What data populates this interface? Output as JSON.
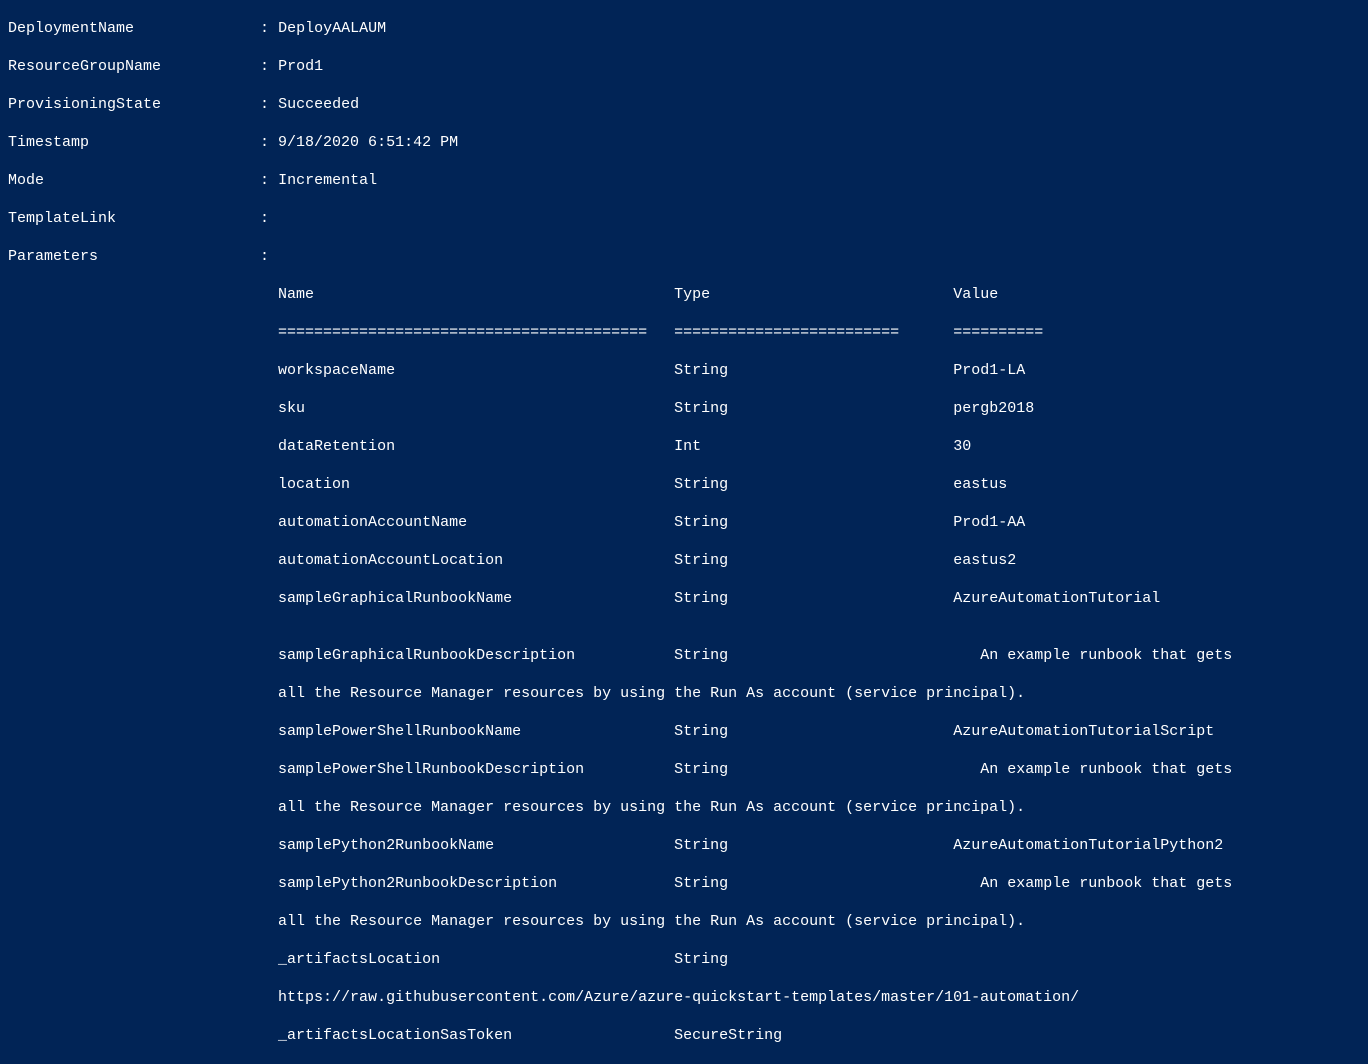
{
  "kv": {
    "deploymentName": {
      "label": "DeploymentName",
      "value": "DeployAALAUM"
    },
    "resourceGroupName": {
      "label": "ResourceGroupName",
      "value": "Prod1"
    },
    "provisioningState": {
      "label": "ProvisioningState",
      "value": "Succeeded"
    },
    "timestamp": {
      "label": "Timestamp",
      "value": "9/18/2020 6:51:42 PM"
    },
    "mode": {
      "label": "Mode",
      "value": "Incremental"
    },
    "templateLink": {
      "label": "TemplateLink",
      "value": ""
    },
    "parameters": {
      "label": "Parameters",
      "value": ""
    }
  },
  "paramsTable": {
    "header": {
      "name": "Name",
      "type": "Type",
      "value": "Value"
    },
    "sep": {
      "name": "=========================================",
      "type": "=========================",
      "value": "=========="
    },
    "rows": [
      {
        "name": "workspaceName",
        "type": "String",
        "value": "Prod1-LA"
      },
      {
        "name": "sku",
        "type": "String",
        "value": "pergb2018"
      },
      {
        "name": "dataRetention",
        "type": "Int",
        "value": "30"
      },
      {
        "name": "location",
        "type": "String",
        "value": "eastus"
      },
      {
        "name": "automationAccountName",
        "type": "String",
        "value": "Prod1-AA"
      },
      {
        "name": "automationAccountLocation",
        "type": "String",
        "value": "eastus2"
      },
      {
        "name": "sampleGraphicalRunbookName",
        "type": "String",
        "value": "AzureAutomationTutorial"
      }
    ],
    "graphicalDescLine1": {
      "name": "sampleGraphicalRunbookDescription",
      "type": "String",
      "value": "   An example runbook that gets"
    },
    "graphicalDescLine2": "all the Resource Manager resources by using the Run As account (service principal).",
    "powershellNameRow": {
      "name": "samplePowerShellRunbookName",
      "type": "String",
      "value": "AzureAutomationTutorialScript"
    },
    "powershellDescLine1": {
      "name": "samplePowerShellRunbookDescription",
      "type": "String",
      "value": "   An example runbook that gets"
    },
    "powershellDescLine2": "all the Resource Manager resources by using the Run As account (service principal).",
    "python2NameRow": {
      "name": "samplePython2RunbookName",
      "type": "String",
      "value": "AzureAutomationTutorialPython2"
    },
    "python2DescLine1": {
      "name": "samplePython2RunbookDescription",
      "type": "String",
      "value": "   An example runbook that gets"
    },
    "python2DescLine2": "all the Resource Manager resources by using the Run As account (service principal).",
    "artifactsLocationRow": {
      "name": "_artifactsLocation",
      "type": "String",
      "value": ""
    },
    "artifactsLocationUrl": "https://raw.githubusercontent.com/Azure/azure-quickstart-templates/master/101-automation/",
    "artifactsSasRow": {
      "name": "_artifactsLocationSasToken",
      "type": "SecureString",
      "value": ""
    }
  }
}
